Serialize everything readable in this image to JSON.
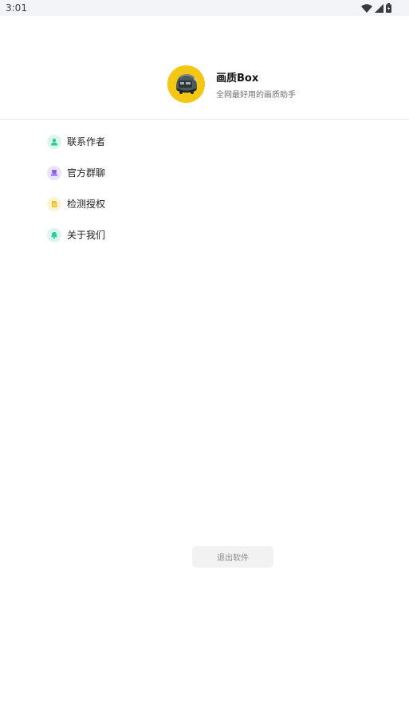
{
  "status_bar": {
    "time": "3:01",
    "icons": [
      "wifi-icon",
      "signal-icon",
      "battery-icon"
    ]
  },
  "header": {
    "app_name": "画质Box",
    "tagline": "全网最好用的画质助手",
    "avatar_icon": "helmet-avatar-icon",
    "avatar_color": "#f3c714"
  },
  "menu": {
    "items": [
      {
        "label": "联系作者",
        "icon": "person-icon",
        "icon_bg": "#d9f7ec",
        "icon_color": "#2fc89a"
      },
      {
        "label": "官方群聊",
        "icon": "group-icon",
        "icon_bg": "#ebe3fb",
        "icon_color": "#8a5cf0"
      },
      {
        "label": "检测授权",
        "icon": "document-icon",
        "icon_bg": "#fdf3d6",
        "icon_color": "#f0c01c"
      },
      {
        "label": "关于我们",
        "icon": "bell-icon",
        "icon_bg": "#d9f7ec",
        "icon_color": "#2fc89a"
      }
    ]
  },
  "footer": {
    "logout_label": "退出软件"
  }
}
